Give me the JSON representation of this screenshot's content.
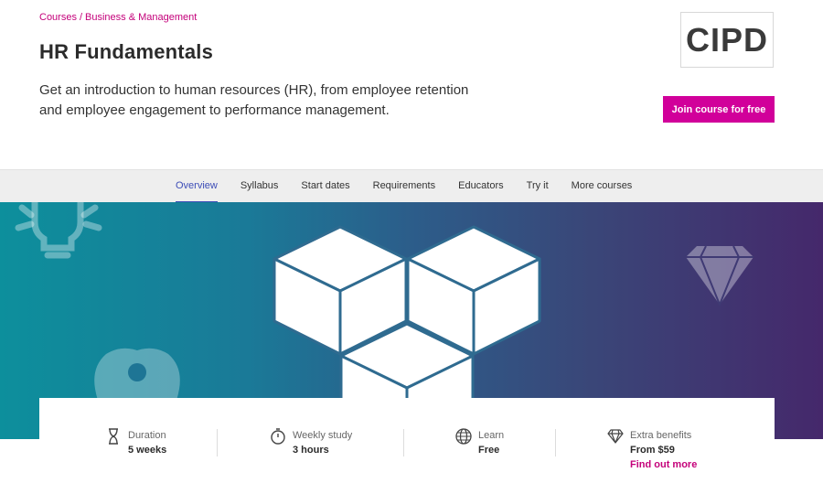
{
  "breadcrumb": {
    "root": "Courses",
    "separator": "/",
    "category": "Business & Management"
  },
  "course": {
    "title": "HR Fundamentals",
    "intro": "Get an introduction to human resources (HR), from employee retention and employee engagement to performance management."
  },
  "logo": {
    "text": "CIPD"
  },
  "cta": {
    "join_label": "Join course for free",
    "color": "#d1009a"
  },
  "nav": {
    "tabs": [
      {
        "label": "Overview",
        "active": true
      },
      {
        "label": "Syllabus"
      },
      {
        "label": "Start dates"
      },
      {
        "label": "Requirements"
      },
      {
        "label": "Educators"
      },
      {
        "label": "Try it"
      },
      {
        "label": "More courses"
      }
    ]
  },
  "hero": {
    "icons": [
      "lightbulb-icon",
      "diamond-icon",
      "apple-icon",
      "cubes-illustration"
    ]
  },
  "info": {
    "duration": {
      "icon": "hourglass-icon",
      "label": "Duration",
      "value": "5 weeks"
    },
    "weekly_study": {
      "icon": "stopwatch-icon",
      "label": "Weekly study",
      "value": "3 hours"
    },
    "learn": {
      "icon": "globe-icon",
      "label": "Learn",
      "value": "Free"
    },
    "extra": {
      "icon": "diamond-outline-icon",
      "label": "Extra benefits",
      "value": "From $59",
      "link": "Find out more"
    }
  },
  "colors": {
    "accent_pink": "#c4007a",
    "nav_active": "#3d4db7"
  }
}
